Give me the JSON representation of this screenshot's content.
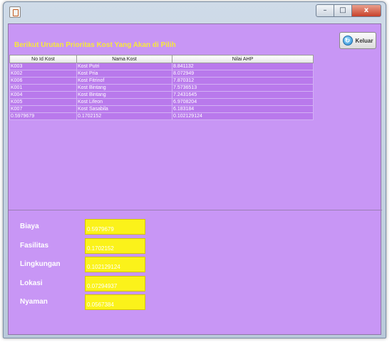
{
  "window": {
    "controls": {
      "minimize": "–",
      "maximize": "□",
      "close": "x"
    }
  },
  "header": {
    "title": "Berikut Urutan Prioritas Kost Yang Akan di Pilih",
    "exit_button": "Keluar"
  },
  "table": {
    "columns": [
      "No Id Kost",
      "Nama Kost",
      "Nilai AHP"
    ],
    "rows": [
      [
        "K003",
        "Kost Putri",
        "8.841132"
      ],
      [
        "K002",
        "Kost Pria",
        "8.072949"
      ],
      [
        "K006",
        "Kost Fitrinof",
        "7.870312"
      ],
      [
        "K001",
        "Kost Bintang",
        "7.5736513"
      ],
      [
        "K004",
        "Kost Bintang",
        "7.2431645"
      ],
      [
        "K005",
        "Kost Lifeon",
        "6.9708204"
      ],
      [
        "K007",
        "Kost Sasabila",
        "6.183184"
      ],
      [
        "0.5979679",
        "0.1702152",
        "0.102129124"
      ]
    ]
  },
  "fields": [
    {
      "label": "Biaya",
      "value": "0.5979679"
    },
    {
      "label": "Fasilitas",
      "value": "0.1702152"
    },
    {
      "label": "Lingkungan",
      "value": "0.102129124"
    },
    {
      "label": "Lokasi",
      "value": "0.07294937"
    },
    {
      "label": "Nyaman",
      "value": "0.0567384"
    }
  ],
  "colors": {
    "panel_background": "#c896f5",
    "row_background": "#b979ec",
    "heading_text": "#f7e93b",
    "field_background": "#fbf21a"
  }
}
